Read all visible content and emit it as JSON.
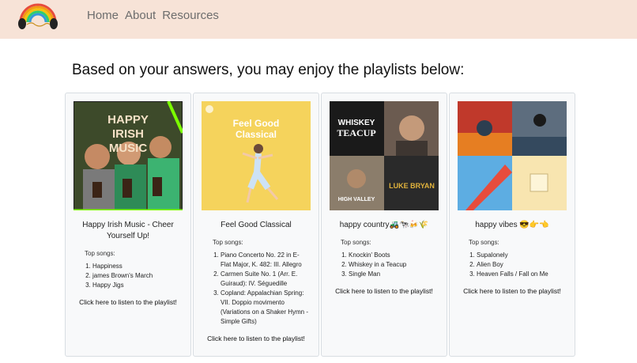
{
  "nav": {
    "links": [
      "Home",
      "About",
      "Resources"
    ]
  },
  "heading": "Based on your answers, you may enjoy the playlists below:",
  "playlists": [
    {
      "cover_text": [
        "HAPPY",
        "IRISH",
        "MUSIC"
      ],
      "title": "Happy Irish Music - Cheer Yourself Up!",
      "top_label": "Top songs:",
      "songs": [
        "Happiness",
        "james Brown's March",
        "Happy Jigs"
      ],
      "link": "Click here to listen to the playlist!"
    },
    {
      "cover_text": [
        "Feel Good",
        "Classical"
      ],
      "title": "Feel Good Classical",
      "top_label": "Top songs:",
      "songs": [
        "Piano Concerto No. 22 in E-Flat Major, K. 482: III. Allegro",
        "Carmen Suite No. 1 (Arr. E. Guiraud): IV. Séguedille",
        "Copland: Appalachian Spring: VII. Doppio movimento (Variations on a Shaker Hymn - Simple Gifts)"
      ],
      "link": "Click here to listen to the playlist!"
    },
    {
      "cover_text": [
        "WHISKEY",
        "TEACUP",
        "HIGH VALLEY",
        "LUKE BRYAN"
      ],
      "title": "happy country🚜🐄🍻🌾",
      "top_label": "Top songs:",
      "songs": [
        "Knockin' Boots",
        "Whiskey in a Teacup",
        "Single Man"
      ],
      "link": "Click here to listen to the playlist!"
    },
    {
      "title": "happy vibes 😎👉👈",
      "top_label": "Top songs:",
      "songs": [
        "Supalonely",
        "Alien Boy",
        "Heaven Falls / Fall on Me"
      ],
      "link": "Click here to listen to the playlist!"
    }
  ],
  "colors": {
    "navbar_bg": "#f7e3d7",
    "nav_link": "#6d6d6d",
    "card_bg": "#f8f9fa"
  }
}
